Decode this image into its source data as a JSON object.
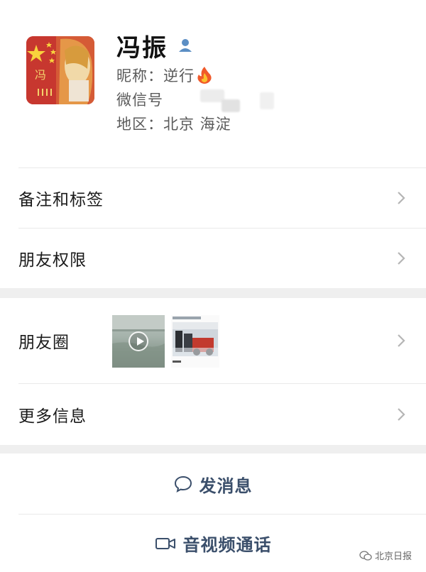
{
  "profile": {
    "name": "冯振",
    "nickname_label": "昵称：逆行",
    "wechat_id_label": "微信号",
    "region_label": "地区：北京 海淀",
    "avatar_glyph": "冯",
    "verified_icon": "person-icon",
    "nickname_emoji": "fire-icon"
  },
  "rows": {
    "remarks": "备注和标签",
    "permissions": "朋友权限",
    "moments": "朋友圈",
    "more_info": "更多信息"
  },
  "moments_thumbs": {
    "video_icon": "play-icon"
  },
  "actions": {
    "message": "发消息",
    "call": "音视频通话"
  },
  "watermark": {
    "text": "北京日报"
  },
  "colors": {
    "action_text": "#3b4f6b",
    "avatar_red": "#c7372f",
    "separator": "#efefef",
    "verified_blue": "#5b8ec4"
  }
}
